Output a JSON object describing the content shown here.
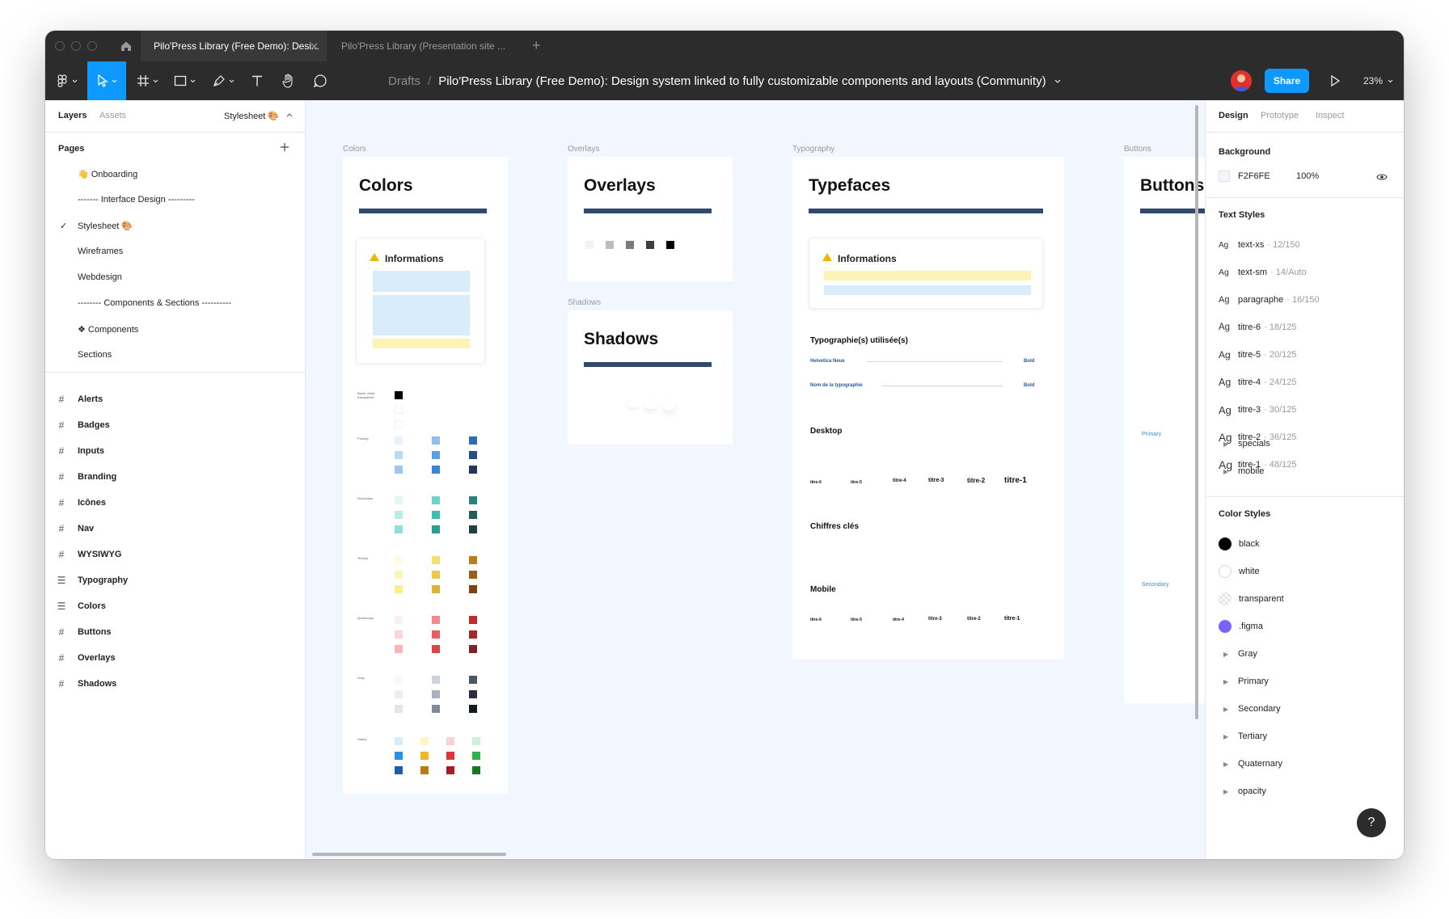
{
  "tabs": [
    {
      "label": "Pilo'Press Library (Free Demo): Desi...",
      "close": "✕"
    },
    {
      "label": "Pilo'Press Library (Presentation site ..."
    }
  ],
  "tab_add": "+",
  "breadcrumb": {
    "drafts": "Drafts",
    "separator": "/",
    "file_name": "Pilo'Press Library (Free Demo): Design system linked to fully customizable components and layouts (Community)"
  },
  "share_label": "Share",
  "zoom_label": "23%",
  "left_panel": {
    "tabs": {
      "layers": "Layers",
      "assets": "Assets",
      "page_selector": "Stylesheet 🎨"
    },
    "pages_title": "Pages",
    "pages": [
      {
        "label": "👋 Onboarding"
      },
      {
        "label": "------- Interface Design ---------"
      },
      {
        "label": "Stylesheet 🎨",
        "selected": true
      },
      {
        "label": "Wireframes"
      },
      {
        "label": "Webdesign"
      },
      {
        "label": "-------- Components & Sections ----------"
      },
      {
        "label": "❖ Components"
      },
      {
        "label": "Sections"
      }
    ],
    "layers": [
      {
        "label": "Alerts",
        "icon": "frame-icon"
      },
      {
        "label": "Badges",
        "icon": "frame-icon"
      },
      {
        "label": "Inputs",
        "icon": "frame-icon"
      },
      {
        "label": "Branding",
        "icon": "frame-icon"
      },
      {
        "label": "Icônes",
        "icon": "frame-icon"
      },
      {
        "label": "Nav",
        "icon": "frame-icon"
      },
      {
        "label": "WYSIWYG",
        "icon": "frame-icon"
      },
      {
        "label": "Typography",
        "icon": "section-icon"
      },
      {
        "label": "Colors",
        "icon": "section-icon"
      },
      {
        "label": "Buttons",
        "icon": "frame-icon"
      },
      {
        "label": "Overlays",
        "icon": "frame-icon"
      },
      {
        "label": "Shadows",
        "icon": "frame-icon"
      }
    ]
  },
  "canvas": {
    "background": "#F2F6FE",
    "frames": {
      "colors": {
        "label": "Colors",
        "title": "Colors",
        "info_title": "Informations"
      },
      "overlays": {
        "label": "Overlays",
        "title": "Overlays"
      },
      "shadows": {
        "label": "Shadows",
        "title": "Shadows"
      },
      "typography": {
        "label": "Typography",
        "title": "Typefaces",
        "info_title": "Informations",
        "used_title": "Typographie(s) utilisée(s)",
        "font1": "Helvetica Neue",
        "font2": "Nom de la typographie",
        "weight1": "Bold",
        "weight2": "Bold",
        "desktop": "Desktop",
        "chiffres": "Chiffres clés",
        "mobile": "Mobile",
        "desktop_titles": [
          "titre-6",
          "titre-5",
          "titre-4",
          "titre-3",
          "titre-2",
          "titre-1"
        ],
        "mobile_titles": [
          "titre-6",
          "titre-5",
          "titre-4",
          "titre-3",
          "titre-2",
          "titre-1"
        ]
      },
      "buttons": {
        "label": "Buttons",
        "title": "Buttons",
        "primary": "Primary",
        "secondary": "Secondary"
      }
    },
    "palette_rows": [
      {
        "label": "Black, white, transparent",
        "colors": [
          "#000000",
          "#ffffff",
          "#ffffff"
        ]
      },
      {
        "label": "Primary",
        "colors": [
          "#e8f1fb",
          "#bcd8f3",
          "#9fc6ee",
          "#8fbfec",
          "#5aa0e2",
          "#3b84d4",
          "#2e6bb5",
          "#284d7e",
          "#22375a"
        ]
      },
      {
        "label": "Secondary",
        "colors": [
          "#e3f7f6",
          "#b8ece8",
          "#8fe0da",
          "#6dd3cc",
          "#3fbdb4",
          "#2a9d96",
          "#2a827d",
          "#265b5b",
          "#1f4243"
        ]
      },
      {
        "label": "Tertiary",
        "colors": [
          "#fdfbe6",
          "#fbf5b7",
          "#f9ef8d",
          "#f4df71",
          "#e9c84d",
          "#d9b33a",
          "#bb7d17",
          "#9b5f17",
          "#7c4414"
        ]
      },
      {
        "label": "Quaternary",
        "colors": [
          "#fdf0f0",
          "#fbd6d6",
          "#f7b5b5",
          "#f18a8a",
          "#e85e5e",
          "#da4545",
          "#bf2b2b",
          "#a32828",
          "#7f2424"
        ]
      },
      {
        "label": "Gray",
        "colors": [
          "#f7f8fa",
          "#eceef2",
          "#e2e5eb",
          "#cdd3dd",
          "#a9b2c1",
          "#7f899a",
          "#4d5666",
          "#2a313d",
          "#151a22"
        ]
      },
      {
        "label": "Status",
        "colors": [
          "#d7edfb",
          "#fdf4c7",
          "#fbd1d1",
          "#cdf1d6",
          "#2f8ee0",
          "#f1b72d",
          "#e2333a",
          "#2fb24a",
          "#1c5fb0",
          "#b97c12",
          "#a91b1f",
          "#17781f"
        ]
      }
    ]
  },
  "right_panel": {
    "tabs": {
      "design": "Design",
      "prototype": "Prototype",
      "inspect": "Inspect"
    },
    "background_title": "Background",
    "background_hex": "F2F6FE",
    "background_opacity": "100%",
    "text_styles_title": "Text Styles",
    "text_styles": [
      {
        "ag": "Ag",
        "name": "text-xs",
        "meta": "· 12/150"
      },
      {
        "ag": "Ag",
        "name": "text-sm",
        "meta": "· 14/Auto"
      },
      {
        "ag": "Ag",
        "name": "paragraphe",
        "meta": "· 16/150"
      },
      {
        "ag": "Ag",
        "name": "titre-6",
        "meta": "· 18/125"
      },
      {
        "ag": "Ag",
        "name": "titre-5",
        "meta": "· 20/125"
      },
      {
        "ag": "Ag",
        "name": "titre-4",
        "meta": "· 24/125"
      },
      {
        "ag": "Ag",
        "name": "titre-3",
        "meta": "· 30/125"
      },
      {
        "ag": "Ag",
        "name": "titre-2",
        "meta": "· 36/125"
      },
      {
        "ag": "Ag",
        "name": "titre-1",
        "meta": "· 48/125"
      }
    ],
    "text_groups": [
      "specials",
      "mobile"
    ],
    "color_styles_title": "Color Styles",
    "color_styles": [
      {
        "name": "black",
        "color": "#000000"
      },
      {
        "name": "white",
        "color": "#ffffff"
      },
      {
        "name": "transparent",
        "color": "transparent"
      },
      {
        "name": ".figma",
        "color": "#7b61ff"
      }
    ],
    "color_groups": [
      "Gray",
      "Primary",
      "Secondary",
      "Tertiary",
      "Quaternary",
      "opacity"
    ]
  },
  "help_label": "?"
}
